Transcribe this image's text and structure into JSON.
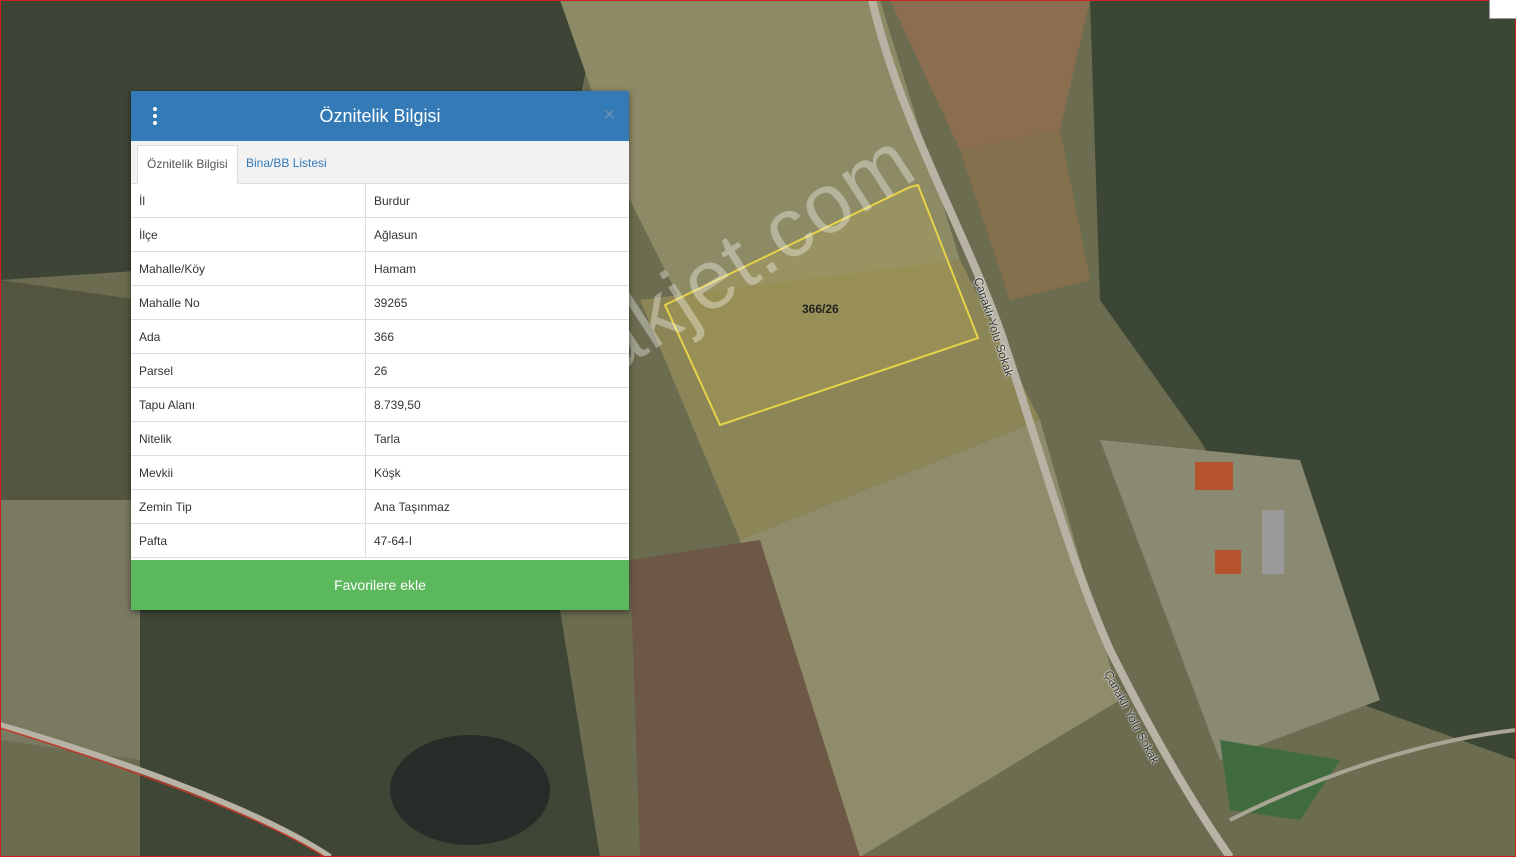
{
  "panel": {
    "title": "Öznitelik Bilgisi",
    "close_label": "×",
    "tabs": [
      {
        "label": "Öznitelik Bilgisi"
      },
      {
        "label": "Bina/BB Listesi"
      }
    ],
    "rows": [
      {
        "key": "İl",
        "value": "Burdur"
      },
      {
        "key": "İlçe",
        "value": "Ağlasun"
      },
      {
        "key": "Mahalle/Köy",
        "value": "Hamam"
      },
      {
        "key": "Mahalle No",
        "value": "39265"
      },
      {
        "key": "Ada",
        "value": "366"
      },
      {
        "key": "Parsel",
        "value": "26"
      },
      {
        "key": "Tapu Alanı",
        "value": "8.739,50"
      },
      {
        "key": "Nitelik",
        "value": "Tarla"
      },
      {
        "key": "Mevkii",
        "value": "Köşk"
      },
      {
        "key": "Zemin Tip",
        "value": "Ana Taşınmaz"
      },
      {
        "key": "Pafta",
        "value": "47-64-I"
      }
    ],
    "favorite_button": "Favorilere ekle"
  },
  "map": {
    "parcel_label": "366/26",
    "road_label_1": "Çanaklı Yolu Sokak",
    "road_label_2": "Çanaklı Yolu Sokak",
    "watermark": "emlakjet.com"
  },
  "colors": {
    "header": "#337ab7",
    "favorite": "#5cb85c",
    "parcel_outline": "#e5d34a"
  }
}
